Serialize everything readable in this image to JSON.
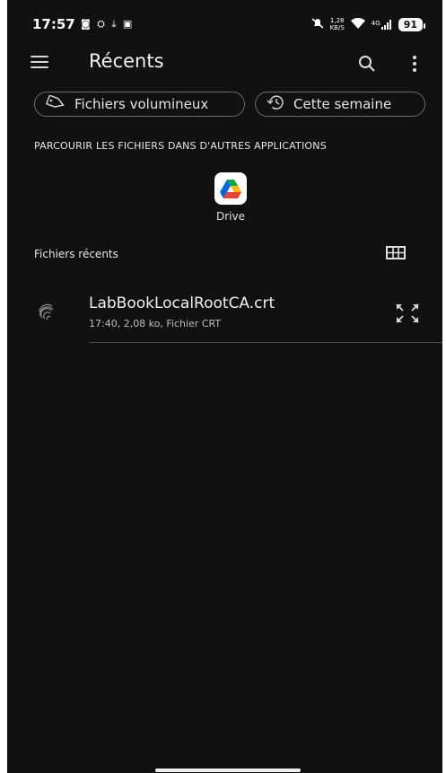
{
  "status_bar": {
    "time": "17:57",
    "left_icons": "◙ ⛭ ⤓ ▣",
    "speed_top": "1,28",
    "speed_bottom": "KB/S",
    "network": "4G",
    "battery": "91"
  },
  "app_bar": {
    "title": "Récents",
    "menu_icon": "menu-icon",
    "search_icon": "search-icon",
    "more_icon": "more-vert-icon"
  },
  "chips": [
    {
      "label": "Fichiers volumineux",
      "icon": "tag-icon"
    },
    {
      "label": "Cette semaine",
      "icon": "history-icon"
    }
  ],
  "browse_section": {
    "label": "PARCOURIR LES FICHIERS DANS D'AUTRES APPLICATIONS",
    "apps": [
      {
        "label": "Drive",
        "icon": "google-drive-icon"
      }
    ]
  },
  "recent_section": {
    "label": "Fichiers récents",
    "view_toggle_icon": "grid-view-icon",
    "files": [
      {
        "name": "LabBookLocalRootCA.crt",
        "meta": "17:40, 2,08 ko, Fichier CRT",
        "icon": "fingerprint-icon",
        "action_icon": "expand-icon"
      }
    ]
  },
  "colors": {
    "background": "#111111",
    "text": "#e8e8e8",
    "chip_border": "#6a6a6a",
    "divider": "#4a4a4a"
  }
}
